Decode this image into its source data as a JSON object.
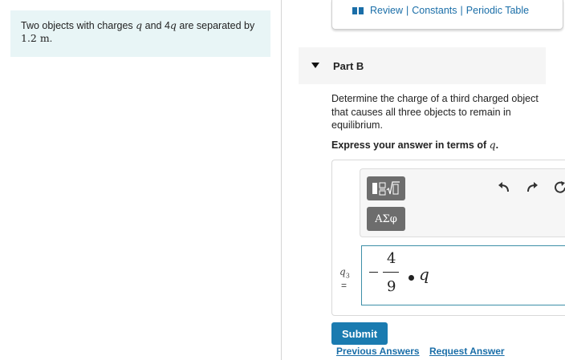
{
  "problem": {
    "text_parts": [
      "Two objects with charges ",
      "q",
      " and 4",
      "q",
      " are separated by ",
      "1.2 m",
      "."
    ]
  },
  "top_links": {
    "review": "Review",
    "separator": "|",
    "constants": "Constants",
    "periodic_table": "Periodic Table"
  },
  "part": {
    "title": "Part B"
  },
  "question": {
    "text": "Determine the charge of a third charged object that causes all three objects to remain in equilibrium.",
    "express_prefix": "Express your answer in terms of ",
    "express_var": "q",
    "express_suffix": "."
  },
  "answer": {
    "greek_label": "ΑΣφ",
    "var_main": "q",
    "var_sub": "3",
    "equals": "=",
    "expression": {
      "numerator": "4",
      "denominator": "9",
      "variable": "q"
    }
  },
  "buttons": {
    "submit": "Submit",
    "previous_answers": "Previous Answers",
    "request_answer": "Request Answer"
  },
  "icons": {
    "templates": "templates-icon",
    "greek": "greek-symbols-icon",
    "undo": "undo-icon",
    "redo": "redo-icon",
    "reset": "reset-icon",
    "collapse": "collapse-triangle-icon",
    "book": "book-icon"
  }
}
